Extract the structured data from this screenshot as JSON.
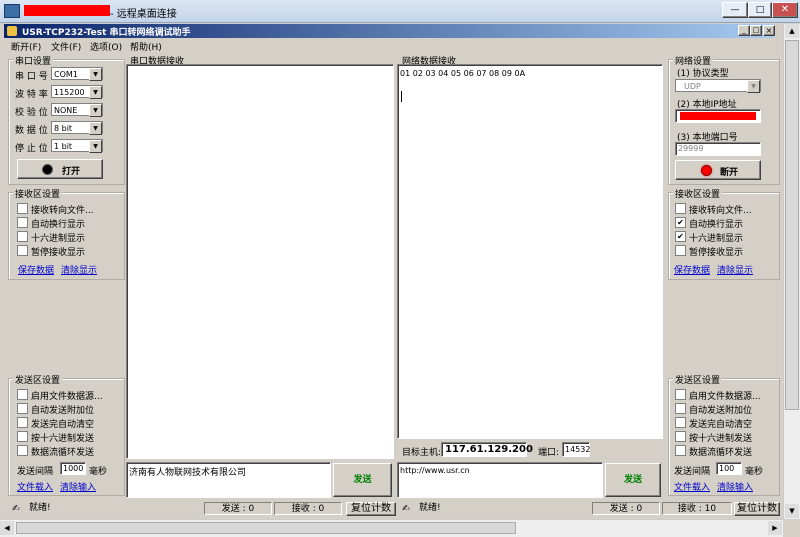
{
  "outer": {
    "title_suffix": " - 远程桌面连接",
    "min": "—",
    "max": "□",
    "close": "✕"
  },
  "app": {
    "title": "USR-TCP232-Test  串口转网络调试助手",
    "min": "_",
    "max": "□",
    "close": "×"
  },
  "menu": [
    "断开(F)",
    "文件(F)",
    "选项(O)",
    "帮助(H)"
  ],
  "serial": {
    "group": "串口设置",
    "port_label": "串 口 号",
    "port": "COM1",
    "baud_label": "波 特 率",
    "baud": "115200",
    "parity_label": "校 验 位",
    "parity": "NONE",
    "data_label": "数 据 位",
    "data": "8 bit",
    "stop_label": "停 止 位",
    "stop": "1 bit",
    "open_btn": "打开"
  },
  "left_rx": {
    "group": "接收区设置",
    "opts": [
      "接收转向文件...",
      "自动换行显示",
      "十六进制显示",
      "暂停接收显示"
    ],
    "save": "保存数据",
    "clear": "清除显示"
  },
  "left_tx": {
    "group": "发送区设置",
    "opts": [
      "启用文件数据源...",
      "自动发送附加位",
      "发送完自动清空",
      "按十六进制发送",
      "数据流循环发送"
    ],
    "interval_label": "发送间隔",
    "interval": "1000",
    "unit": "毫秒",
    "load": "文件载入",
    "clear": "清除输入"
  },
  "serial_rx": {
    "title": "串口数据接收",
    "content": ""
  },
  "serial_tx": {
    "content": "济南有人物联网技术有限公司",
    "send": "发送"
  },
  "net_rx": {
    "title": "网络数据接收",
    "content": "01 02 03 04 05 06 07 08 09 0A"
  },
  "net_target": {
    "host_label": "目标主机:",
    "host": "117.61.129.200",
    "port_label": "端口:",
    "port": "14532"
  },
  "net_tx": {
    "content": "http://www.usr.cn",
    "send": "发送"
  },
  "net": {
    "group": "网络设置",
    "proto_label": "(1) 协议类型",
    "proto": "UDP",
    "ip_label": "(2) 本地IP地址",
    "ip": "",
    "port_label": "(3) 本地端口号",
    "port": "29999",
    "disconnect_btn": "断开"
  },
  "right_rx": {
    "group": "接收区设置",
    "opts": [
      "接收转向文件...",
      "自动换行显示",
      "十六进制显示",
      "暂停接收显示"
    ],
    "checked": [
      false,
      true,
      true,
      false
    ],
    "save": "保存数据",
    "clear": "清除显示"
  },
  "right_tx": {
    "group": "发送区设置",
    "opts": [
      "启用文件数据源...",
      "自动发送附加位",
      "发送完自动清空",
      "按十六进制发送",
      "数据流循环发送"
    ],
    "interval_label": "发送间隔",
    "interval": "100",
    "unit": "毫秒",
    "load": "文件载入",
    "clear": "清除输入"
  },
  "status": {
    "ready_l": "就绪!",
    "send_l": "发送 : 0",
    "recv_l": "接收 : 0",
    "reset_l": "复位计数",
    "ready_r": "就绪!",
    "send_r": "发送 : 0",
    "recv_r": "接收 : 10",
    "reset_r": "复位计数"
  },
  "colors": {
    "titlebar_start": "#0a246a",
    "titlebar_end": "#a6caf0",
    "redacted": "#ff0000"
  }
}
